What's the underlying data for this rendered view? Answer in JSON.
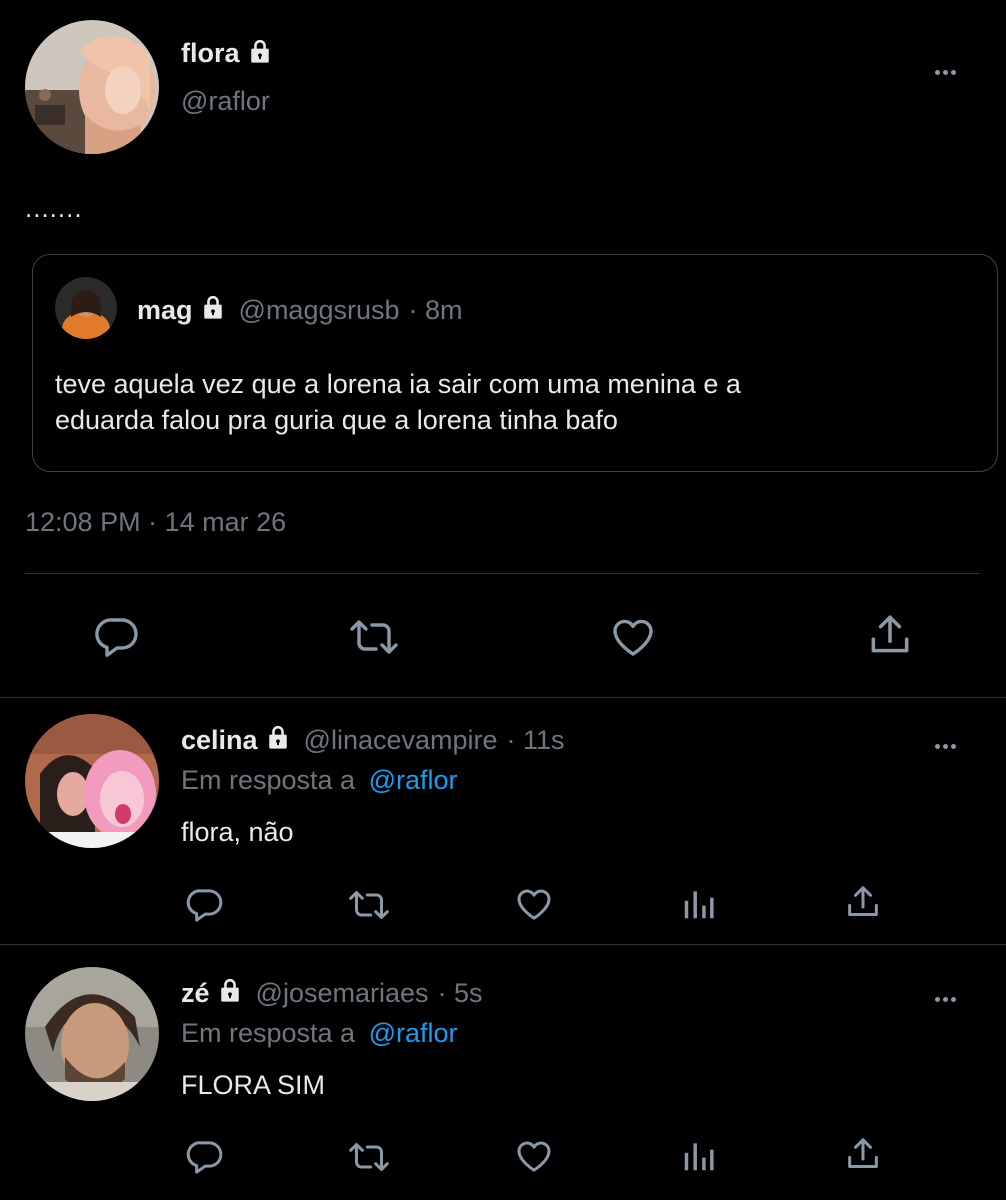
{
  "main_tweet": {
    "name": "flora",
    "handle": "@raflor",
    "text": ".......",
    "quoted": {
      "name": "mag",
      "handle": "@maggsrusb",
      "time": "· 8m",
      "text_line1": "teve aquela vez que a lorena ia sair com uma menina e a",
      "text_line2": "eduarda falou pra guria que a lorena tinha bafo"
    },
    "timestamp": "12:08 PM · 14 mar 26"
  },
  "replies": [
    {
      "name": "celina",
      "handle": "@linacevampire",
      "time": "· 11s",
      "reply_prefix": "Em resposta a",
      "reply_to": "@raflor",
      "text": "flora, não"
    },
    {
      "name": "zé",
      "handle": "@josemariaes",
      "time": "· 5s",
      "reply_prefix": "Em resposta a",
      "reply_to": "@raflor",
      "text": "FLORA SIM"
    }
  ],
  "colors": {
    "background": "#000000",
    "text": "#e7e9ea",
    "muted": "#6e767d",
    "link": "#1d9bf0",
    "icon": "#8b98a5",
    "border": "#2f3336"
  },
  "icons": [
    "lock-icon",
    "more-icon",
    "reply-icon",
    "retweet-icon",
    "like-icon",
    "views-icon",
    "share-icon"
  ]
}
